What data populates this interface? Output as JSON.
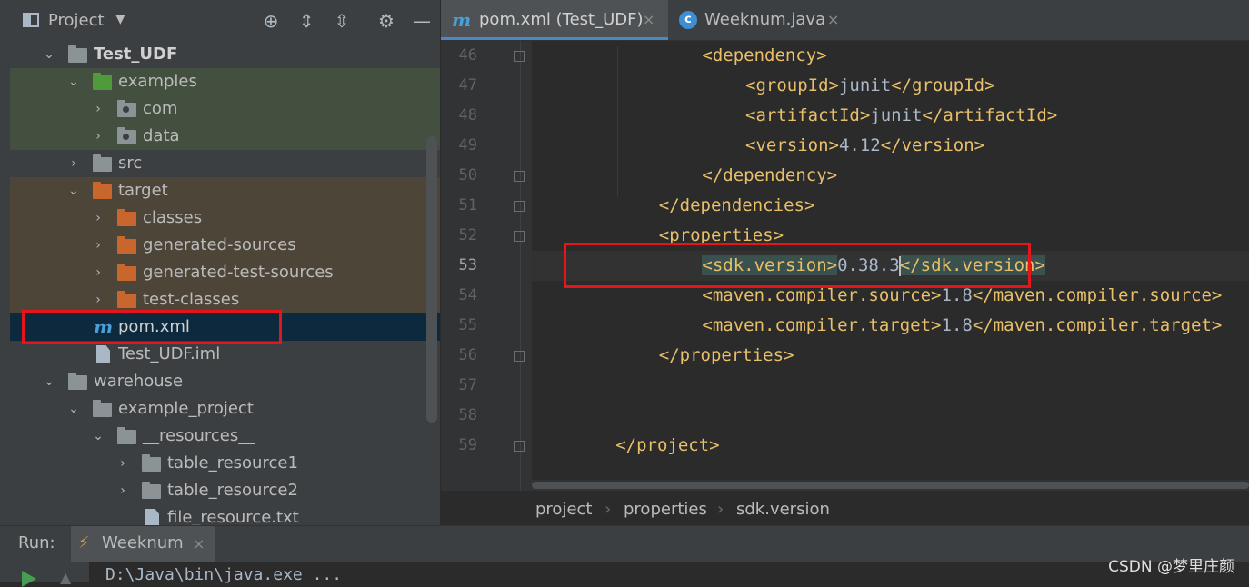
{
  "project_panel": {
    "title": "Project",
    "toolbar_icons": [
      "target-icon",
      "expand-all-icon",
      "collapse-all-icon",
      "gear-icon",
      "minimize-icon"
    ],
    "tree": [
      {
        "label": "Test_UDF",
        "bold": true
      },
      {
        "label": "examples"
      },
      {
        "label": "com"
      },
      {
        "label": "data"
      },
      {
        "label": "src"
      },
      {
        "label": "target"
      },
      {
        "label": "classes"
      },
      {
        "label": "generated-sources"
      },
      {
        "label": "generated-test-sources"
      },
      {
        "label": "test-classes"
      },
      {
        "label": "pom.xml"
      },
      {
        "label": "Test_UDF.iml"
      },
      {
        "label": "warehouse"
      },
      {
        "label": "example_project"
      },
      {
        "label": "__resources__"
      },
      {
        "label": "table_resource1"
      },
      {
        "label": "table_resource2"
      },
      {
        "label": "file_resource.txt"
      }
    ]
  },
  "editor": {
    "tabs": [
      {
        "label": "pom.xml (Test_UDF)",
        "active": true,
        "icon": "maven-icon"
      },
      {
        "label": "Weeknum.java",
        "active": false,
        "icon": "class-icon"
      }
    ],
    "close_glyph": "×",
    "current_line": 53,
    "lines": [
      {
        "n": "46",
        "parts": [
          {
            "t": "tag",
            "v": "<dependency>"
          }
        ]
      },
      {
        "n": "47",
        "parts": [
          {
            "t": "tag",
            "v": "<groupId>"
          },
          {
            "t": "txt",
            "v": "junit"
          },
          {
            "t": "tag",
            "v": "</groupId>"
          }
        ]
      },
      {
        "n": "48",
        "parts": [
          {
            "t": "tag",
            "v": "<artifactId>"
          },
          {
            "t": "txt",
            "v": "junit"
          },
          {
            "t": "tag",
            "v": "</artifactId>"
          }
        ]
      },
      {
        "n": "49",
        "parts": [
          {
            "t": "tag",
            "v": "<version>"
          },
          {
            "t": "txt",
            "v": "4.12"
          },
          {
            "t": "tag",
            "v": "</version>"
          }
        ]
      },
      {
        "n": "50",
        "parts": [
          {
            "t": "tag",
            "v": "</dependency>"
          }
        ]
      },
      {
        "n": "51",
        "parts": [
          {
            "t": "tag",
            "v": "</dependencies>"
          }
        ]
      },
      {
        "n": "52",
        "parts": [
          {
            "t": "tag",
            "v": "<properties>"
          }
        ]
      },
      {
        "n": "53",
        "parts": [
          {
            "t": "tag",
            "v": "<sdk.version>"
          },
          {
            "t": "txt",
            "v": "0.38.3"
          },
          {
            "t": "tag",
            "v": "</sdk.version>"
          }
        ]
      },
      {
        "n": "54",
        "parts": [
          {
            "t": "tag",
            "v": "<maven.compiler.source>"
          },
          {
            "t": "txt",
            "v": "1.8"
          },
          {
            "t": "tag",
            "v": "</maven.compiler.source>"
          }
        ]
      },
      {
        "n": "55",
        "parts": [
          {
            "t": "tag",
            "v": "<maven.compiler.target>"
          },
          {
            "t": "txt",
            "v": "1.8"
          },
          {
            "t": "tag",
            "v": "</maven.compiler.target>"
          }
        ]
      },
      {
        "n": "56",
        "parts": [
          {
            "t": "tag",
            "v": "</properties>"
          }
        ]
      },
      {
        "n": "57",
        "parts": []
      },
      {
        "n": "58",
        "parts": []
      },
      {
        "n": "59",
        "parts": [
          {
            "t": "tag",
            "v": "</project>"
          }
        ]
      }
    ],
    "breadcrumb": [
      "project",
      "properties",
      "sdk.version"
    ],
    "breadcrumb_separator": "›"
  },
  "run_panel": {
    "label": "Run:",
    "tab_label": "Weeknum",
    "output_text": "D:\\Java\\bin\\java.exe ..."
  },
  "watermark": "CSDN @梦里庄颜",
  "colors": {
    "tag": "#e8bf6a",
    "text": "#a9b7c6",
    "annotation": "#e8141b",
    "selection": "#0d293e"
  }
}
